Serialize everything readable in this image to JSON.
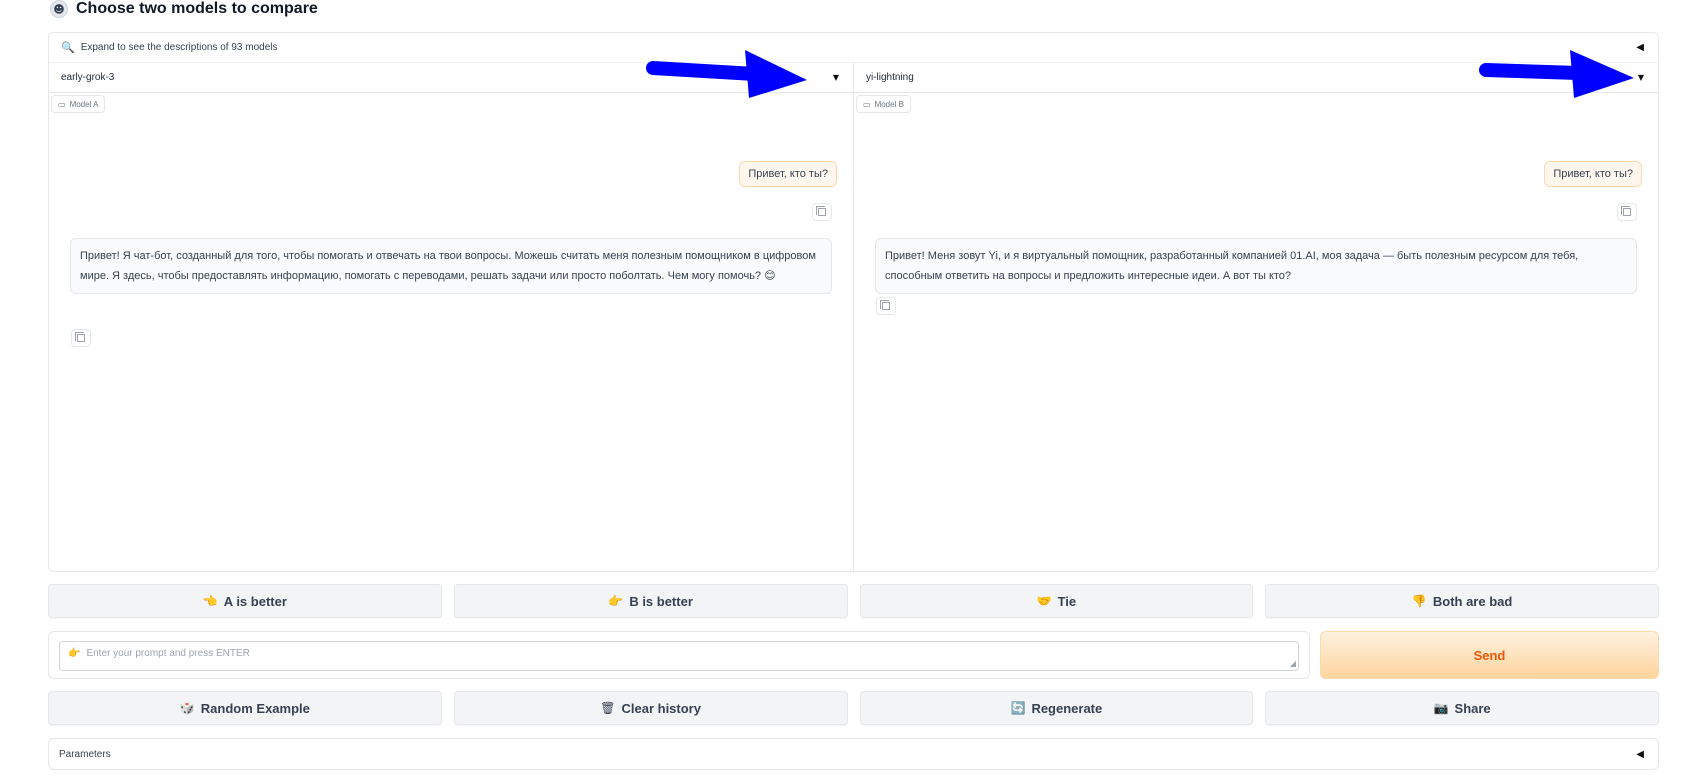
{
  "header": {
    "title": "Choose two models to compare",
    "icon": "robot-icon"
  },
  "models_panel": {
    "expand_label": "Expand to see the descriptions of 93 models",
    "model_a": {
      "selected": "early-grok-3",
      "tag": "Model A",
      "user_message": "Привет, кто ты?",
      "bot_message": "Привет! Я чат-бот, созданный для того, чтобы помогать и отвечать на твои вопросы. Можешь считать меня полезным помощником в цифровом мире. Я здесь, чтобы предоставлять информацию, помогать с переводами, решать задачи или просто поболтать. Чем могу помочь? 😊"
    },
    "model_b": {
      "selected": "yi-lightning",
      "tag": "Model B",
      "user_message": "Привет, кто ты?",
      "bot_message": "Привет! Меня зовут Yi, и я виртуальный помощник, разработанный компанией 01.AI, моя задача — быть полезным ресурсом для тебя, способным ответить на вопросы и предложить интересные идеи. А вот ты кто?"
    }
  },
  "vote_buttons": [
    {
      "emoji": "👈",
      "label": "A is better"
    },
    {
      "emoji": "👉",
      "label": "B is better"
    },
    {
      "emoji": "🤝",
      "label": "Tie"
    },
    {
      "emoji": "👎",
      "label": "Both are bad"
    }
  ],
  "prompt": {
    "emoji": "👉",
    "placeholder": "Enter your prompt and press ENTER",
    "value": ""
  },
  "send_label": "Send",
  "action_buttons": [
    {
      "emoji": "🎲",
      "label": "Random Example"
    },
    {
      "emoji": "🗑",
      "label": "Clear history"
    },
    {
      "emoji": "🔄",
      "label": "Regenerate"
    },
    {
      "emoji": "📷",
      "label": "Share"
    }
  ],
  "parameters_label": "Parameters",
  "colors": {
    "accent": "#ea580c",
    "annotation_arrow": "#0000ff"
  }
}
